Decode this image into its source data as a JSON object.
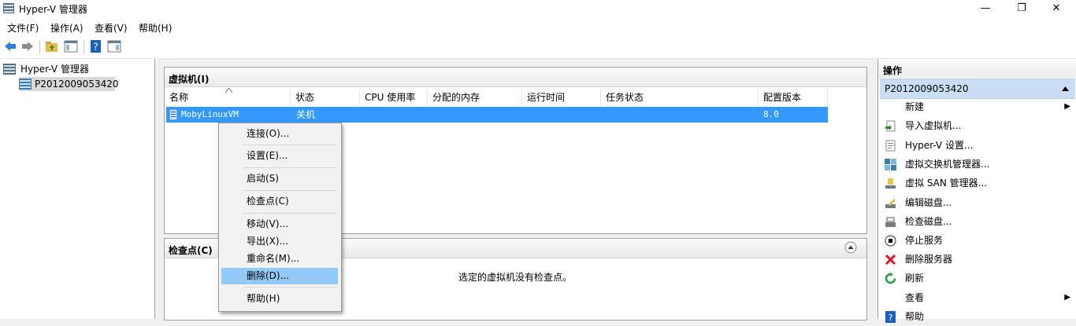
{
  "window": {
    "title": "Hyper-V 管理器",
    "minimize": "—",
    "restore": "❐",
    "close": "✕"
  },
  "menu": [
    "文件(F)",
    "操作(A)",
    "查看(V)",
    "帮助(H)"
  ],
  "tree": {
    "root": "Hyper-V 管理器",
    "server": "P2012009053420"
  },
  "vm_panel": {
    "title": "虚拟机(I)",
    "columns": [
      "名称",
      "状态",
      "CPU 使用率",
      "分配的内存",
      "运行时间",
      "任务状态",
      "配置版本"
    ],
    "rows": [
      {
        "name": "MobyLinuxVM",
        "state": "关机",
        "cpu": "",
        "memory": "",
        "uptime": "",
        "task": "",
        "version": "8.0"
      }
    ]
  },
  "checkpoint_panel": {
    "title": "检查点(C)",
    "empty_text": "选定的虚拟机没有检查点。"
  },
  "context_menu": [
    {
      "label": "连接(O)..."
    },
    {
      "label": "设置(E)..."
    },
    {
      "label": "启动(S)"
    },
    {
      "label": "检查点(C)"
    },
    {
      "label": "移动(V)..."
    },
    {
      "label": "导出(X)..."
    },
    {
      "label": "重命名(M)..."
    },
    {
      "label": "删除(D)..."
    },
    {
      "label": "帮助(H)"
    }
  ],
  "actions": {
    "title": "操作",
    "group": "P2012009053420",
    "items": [
      {
        "label": "新建",
        "icon": "none"
      },
      {
        "label": "导入虚拟机...",
        "icon": "import-vm-icon"
      },
      {
        "label": "Hyper-V 设置...",
        "icon": "settings-document-icon"
      },
      {
        "label": "虚拟交换机管理器...",
        "icon": "virtual-switch-icon"
      },
      {
        "label": "虚拟 SAN 管理器...",
        "icon": "virtual-san-icon"
      },
      {
        "label": "编辑磁盘...",
        "icon": "edit-disk-icon"
      },
      {
        "label": "检查磁盘...",
        "icon": "inspect-disk-icon"
      },
      {
        "label": "停止服务",
        "icon": "stop-service-icon"
      },
      {
        "label": "删除服务器",
        "icon": "remove-server-icon"
      },
      {
        "label": "刷新",
        "icon": "refresh-icon"
      },
      {
        "label": "查看",
        "icon": "none"
      },
      {
        "label": "帮助",
        "icon": "help-icon"
      }
    ]
  },
  "colors": {
    "selection": "#3399ff",
    "menu_highlight": "#91c9f7",
    "action_group": "#c9def4",
    "delete_red": "#e81123",
    "refresh_green": "#1e9e3c"
  }
}
